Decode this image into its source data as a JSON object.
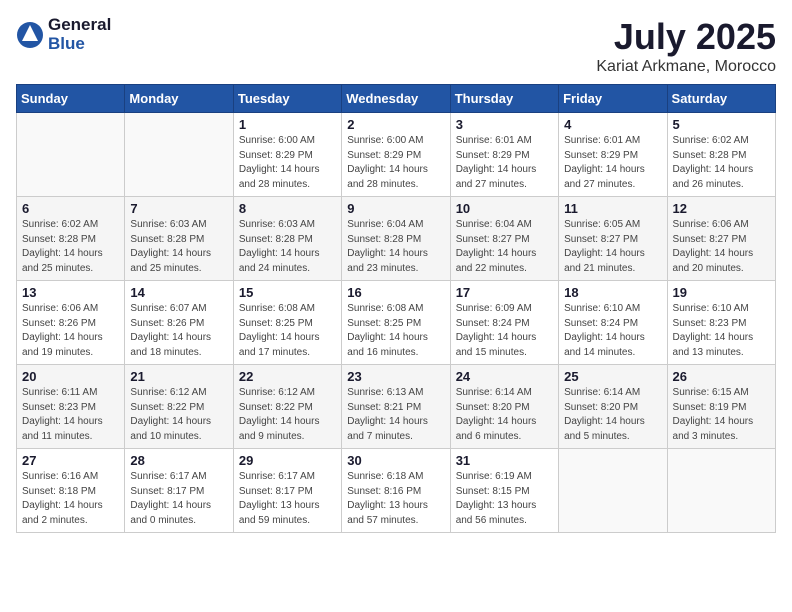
{
  "header": {
    "logo_general": "General",
    "logo_blue": "Blue",
    "month": "July 2025",
    "location": "Kariat Arkmane, Morocco"
  },
  "weekdays": [
    "Sunday",
    "Monday",
    "Tuesday",
    "Wednesday",
    "Thursday",
    "Friday",
    "Saturday"
  ],
  "weeks": [
    [
      {
        "day": "",
        "sunrise": "",
        "sunset": "",
        "daylight": ""
      },
      {
        "day": "",
        "sunrise": "",
        "sunset": "",
        "daylight": ""
      },
      {
        "day": "1",
        "sunrise": "Sunrise: 6:00 AM",
        "sunset": "Sunset: 8:29 PM",
        "daylight": "Daylight: 14 hours and 28 minutes."
      },
      {
        "day": "2",
        "sunrise": "Sunrise: 6:00 AM",
        "sunset": "Sunset: 8:29 PM",
        "daylight": "Daylight: 14 hours and 28 minutes."
      },
      {
        "day": "3",
        "sunrise": "Sunrise: 6:01 AM",
        "sunset": "Sunset: 8:29 PM",
        "daylight": "Daylight: 14 hours and 27 minutes."
      },
      {
        "day": "4",
        "sunrise": "Sunrise: 6:01 AM",
        "sunset": "Sunset: 8:29 PM",
        "daylight": "Daylight: 14 hours and 27 minutes."
      },
      {
        "day": "5",
        "sunrise": "Sunrise: 6:02 AM",
        "sunset": "Sunset: 8:28 PM",
        "daylight": "Daylight: 14 hours and 26 minutes."
      }
    ],
    [
      {
        "day": "6",
        "sunrise": "Sunrise: 6:02 AM",
        "sunset": "Sunset: 8:28 PM",
        "daylight": "Daylight: 14 hours and 25 minutes."
      },
      {
        "day": "7",
        "sunrise": "Sunrise: 6:03 AM",
        "sunset": "Sunset: 8:28 PM",
        "daylight": "Daylight: 14 hours and 25 minutes."
      },
      {
        "day": "8",
        "sunrise": "Sunrise: 6:03 AM",
        "sunset": "Sunset: 8:28 PM",
        "daylight": "Daylight: 14 hours and 24 minutes."
      },
      {
        "day": "9",
        "sunrise": "Sunrise: 6:04 AM",
        "sunset": "Sunset: 8:28 PM",
        "daylight": "Daylight: 14 hours and 23 minutes."
      },
      {
        "day": "10",
        "sunrise": "Sunrise: 6:04 AM",
        "sunset": "Sunset: 8:27 PM",
        "daylight": "Daylight: 14 hours and 22 minutes."
      },
      {
        "day": "11",
        "sunrise": "Sunrise: 6:05 AM",
        "sunset": "Sunset: 8:27 PM",
        "daylight": "Daylight: 14 hours and 21 minutes."
      },
      {
        "day": "12",
        "sunrise": "Sunrise: 6:06 AM",
        "sunset": "Sunset: 8:27 PM",
        "daylight": "Daylight: 14 hours and 20 minutes."
      }
    ],
    [
      {
        "day": "13",
        "sunrise": "Sunrise: 6:06 AM",
        "sunset": "Sunset: 8:26 PM",
        "daylight": "Daylight: 14 hours and 19 minutes."
      },
      {
        "day": "14",
        "sunrise": "Sunrise: 6:07 AM",
        "sunset": "Sunset: 8:26 PM",
        "daylight": "Daylight: 14 hours and 18 minutes."
      },
      {
        "day": "15",
        "sunrise": "Sunrise: 6:08 AM",
        "sunset": "Sunset: 8:25 PM",
        "daylight": "Daylight: 14 hours and 17 minutes."
      },
      {
        "day": "16",
        "sunrise": "Sunrise: 6:08 AM",
        "sunset": "Sunset: 8:25 PM",
        "daylight": "Daylight: 14 hours and 16 minutes."
      },
      {
        "day": "17",
        "sunrise": "Sunrise: 6:09 AM",
        "sunset": "Sunset: 8:24 PM",
        "daylight": "Daylight: 14 hours and 15 minutes."
      },
      {
        "day": "18",
        "sunrise": "Sunrise: 6:10 AM",
        "sunset": "Sunset: 8:24 PM",
        "daylight": "Daylight: 14 hours and 14 minutes."
      },
      {
        "day": "19",
        "sunrise": "Sunrise: 6:10 AM",
        "sunset": "Sunset: 8:23 PM",
        "daylight": "Daylight: 14 hours and 13 minutes."
      }
    ],
    [
      {
        "day": "20",
        "sunrise": "Sunrise: 6:11 AM",
        "sunset": "Sunset: 8:23 PM",
        "daylight": "Daylight: 14 hours and 11 minutes."
      },
      {
        "day": "21",
        "sunrise": "Sunrise: 6:12 AM",
        "sunset": "Sunset: 8:22 PM",
        "daylight": "Daylight: 14 hours and 10 minutes."
      },
      {
        "day": "22",
        "sunrise": "Sunrise: 6:12 AM",
        "sunset": "Sunset: 8:22 PM",
        "daylight": "Daylight: 14 hours and 9 minutes."
      },
      {
        "day": "23",
        "sunrise": "Sunrise: 6:13 AM",
        "sunset": "Sunset: 8:21 PM",
        "daylight": "Daylight: 14 hours and 7 minutes."
      },
      {
        "day": "24",
        "sunrise": "Sunrise: 6:14 AM",
        "sunset": "Sunset: 8:20 PM",
        "daylight": "Daylight: 14 hours and 6 minutes."
      },
      {
        "day": "25",
        "sunrise": "Sunrise: 6:14 AM",
        "sunset": "Sunset: 8:20 PM",
        "daylight": "Daylight: 14 hours and 5 minutes."
      },
      {
        "day": "26",
        "sunrise": "Sunrise: 6:15 AM",
        "sunset": "Sunset: 8:19 PM",
        "daylight": "Daylight: 14 hours and 3 minutes."
      }
    ],
    [
      {
        "day": "27",
        "sunrise": "Sunrise: 6:16 AM",
        "sunset": "Sunset: 8:18 PM",
        "daylight": "Daylight: 14 hours and 2 minutes."
      },
      {
        "day": "28",
        "sunrise": "Sunrise: 6:17 AM",
        "sunset": "Sunset: 8:17 PM",
        "daylight": "Daylight: 14 hours and 0 minutes."
      },
      {
        "day": "29",
        "sunrise": "Sunrise: 6:17 AM",
        "sunset": "Sunset: 8:17 PM",
        "daylight": "Daylight: 13 hours and 59 minutes."
      },
      {
        "day": "30",
        "sunrise": "Sunrise: 6:18 AM",
        "sunset": "Sunset: 8:16 PM",
        "daylight": "Daylight: 13 hours and 57 minutes."
      },
      {
        "day": "31",
        "sunrise": "Sunrise: 6:19 AM",
        "sunset": "Sunset: 8:15 PM",
        "daylight": "Daylight: 13 hours and 56 minutes."
      },
      {
        "day": "",
        "sunrise": "",
        "sunset": "",
        "daylight": ""
      },
      {
        "day": "",
        "sunrise": "",
        "sunset": "",
        "daylight": ""
      }
    ]
  ]
}
